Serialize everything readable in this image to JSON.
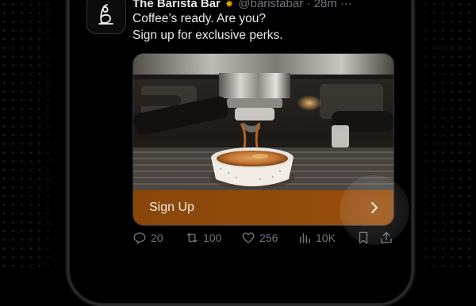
{
  "tweet": {
    "author": "The Barista Bar",
    "handle": "@baristabar",
    "separator": "·",
    "time": "28m",
    "more": "···",
    "text_line1": "Coffee’s ready. Are you?",
    "text_line2": "Sign up for exclusive perks."
  },
  "card": {
    "cta_label": "Sign Up"
  },
  "actions": {
    "replies": "20",
    "reposts": "100",
    "likes": "256",
    "views": "10K"
  },
  "colors": {
    "cta": "#8a4608",
    "background": "#000000",
    "text": "#e7e9ea",
    "muted": "#71767b",
    "verified": "#e2a400"
  },
  "icons": [
    "barista-logo-icon",
    "verified-badge-icon",
    "chevron-right-icon",
    "reply-icon",
    "repost-icon",
    "like-icon",
    "views-icon",
    "bookmark-icon",
    "share-icon"
  ]
}
